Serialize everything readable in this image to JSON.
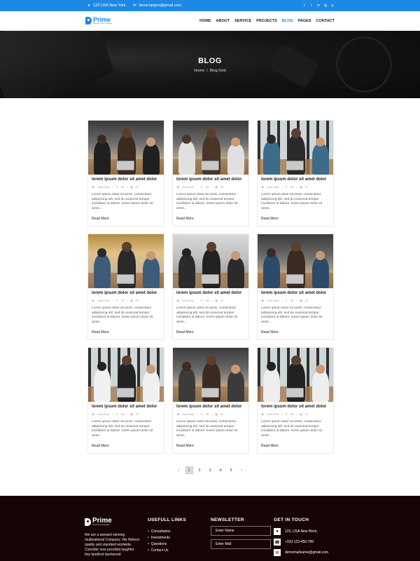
{
  "topbar": {
    "address": "123 USA New York",
    "email": "devscriptpro@gmail.com",
    "social": [
      "f",
      "t",
      "in",
      "ig",
      "p"
    ]
  },
  "nav": {
    "logo_title": "Prime",
    "logo_sub": "Business and Corporate",
    "menu": [
      "HOME",
      "ABOUT",
      "SERVICE",
      "PROJECTS",
      "BLOG",
      "PAGES",
      "CONTACT"
    ],
    "active": "BLOG"
  },
  "hero": {
    "title": "BLOG",
    "breadcrumb_home": "Home",
    "breadcrumb_sep": "/",
    "breadcrumb_current": "Blog Grid"
  },
  "posts": [
    {
      "title": "lorem ipsum dolor sit amet dolor",
      "author": "John Doe",
      "comments": "28",
      "views": "37",
      "text": "Lorem ipsum dolor sit amet, consectetur adipisicing elit, sed do eiusmod tempor incididunt ut labore. lorem ipsum dolor sit amet...",
      "more": "Read More"
    },
    {
      "title": "lorem ipsum dolor sit amet dolor",
      "author": "John Doe",
      "comments": "28",
      "views": "37",
      "text": "Lorem ipsum dolor sit amet, consectetur adipisicing elit, sed do eiusmod tempor incididunt ut labore. lorem ipsum dolor sit amet...",
      "more": "Read More"
    },
    {
      "title": "lorem ipsum dolor sit amet dolor",
      "author": "John Doe",
      "comments": "28",
      "views": "37",
      "text": "Lorem ipsum dolor sit amet, consectetur adipisicing elit, sed do eiusmod tempor incididunt ut labore. lorem ipsum dolor sit amet...",
      "more": "Read More"
    },
    {
      "title": "lorem ipsum dolor sit amet dolor",
      "author": "John Doe",
      "comments": "28",
      "views": "37",
      "text": "Lorem ipsum dolor sit amet, consectetur adipisicing elit, sed do eiusmod tempor incididunt ut labore. lorem ipsum dolor sit amet...",
      "more": "Read More"
    },
    {
      "title": "lorem ipsum dolor sit amet dolor",
      "author": "John Doe",
      "comments": "28",
      "views": "37",
      "text": "Lorem ipsum dolor sit amet, consectetur adipisicing elit, sed do eiusmod tempor incididunt ut labore. lorem ipsum dolor sit amet...",
      "more": "Read More"
    },
    {
      "title": "lorem ipsum dolor sit amet dolor",
      "author": "John Doe",
      "comments": "28",
      "views": "37",
      "text": "Lorem ipsum dolor sit amet, consectetur adipisicing elit, sed do eiusmod tempor incididunt ut labore. lorem ipsum dolor sit amet...",
      "more": "Read More"
    },
    {
      "title": "lorem ipsum dolor sit amet dolor",
      "author": "John Doe",
      "comments": "28",
      "views": "37",
      "text": "Lorem ipsum dolor sit amet, consectetur adipisicing elit, sed do eiusmod tempor incididunt ut labore. lorem ipsum dolor sit amet...",
      "more": "Read More"
    },
    {
      "title": "lorem ipsum dolor sit amet dolor",
      "author": "John Doe",
      "comments": "28",
      "views": "37",
      "text": "Lorem ipsum dolor sit amet, consectetur adipisicing elit, sed do eiusmod tempor incididunt ut labore. lorem ipsum dolor sit amet...",
      "more": "Read More"
    },
    {
      "title": "lorem ipsum dolor sit amet dolor",
      "author": "John Doe",
      "comments": "28",
      "views": "37",
      "text": "Lorem ipsum dolor sit amet, consectetur adipisicing elit, sed do eiusmod tempor incididunt ut labore. lorem ipsum dolor sit amet...",
      "more": "Read More"
    }
  ],
  "pagination": {
    "prev": "‹",
    "pages": [
      "1",
      "2",
      "3",
      "4",
      "5"
    ],
    "active": "1",
    "next": "›"
  },
  "footer": {
    "logo_title": "Prime",
    "logo_sub": "Business & Corporate",
    "about": "We are a awward winning multinational Company. We Believe quality and standard worlwide. Consider now provided laughter boy landlord dashwood.",
    "links_heading": "USEFULL LINKS",
    "links": [
      "Consultation",
      "Investments",
      "Questions",
      "Contact Us"
    ],
    "newsletter_heading": "NEWSLETTER",
    "name_placeholder": "Enter Name",
    "mail_placeholder": "Enter Mail",
    "contact_heading": "GET IN TOUCH",
    "address": "123, USA New Work.",
    "phone": "+333 123-456-789",
    "email": "demomailname@gmail.com"
  },
  "colors": {
    "accent": "#1e88e5",
    "footer_bg": "#170404"
  }
}
